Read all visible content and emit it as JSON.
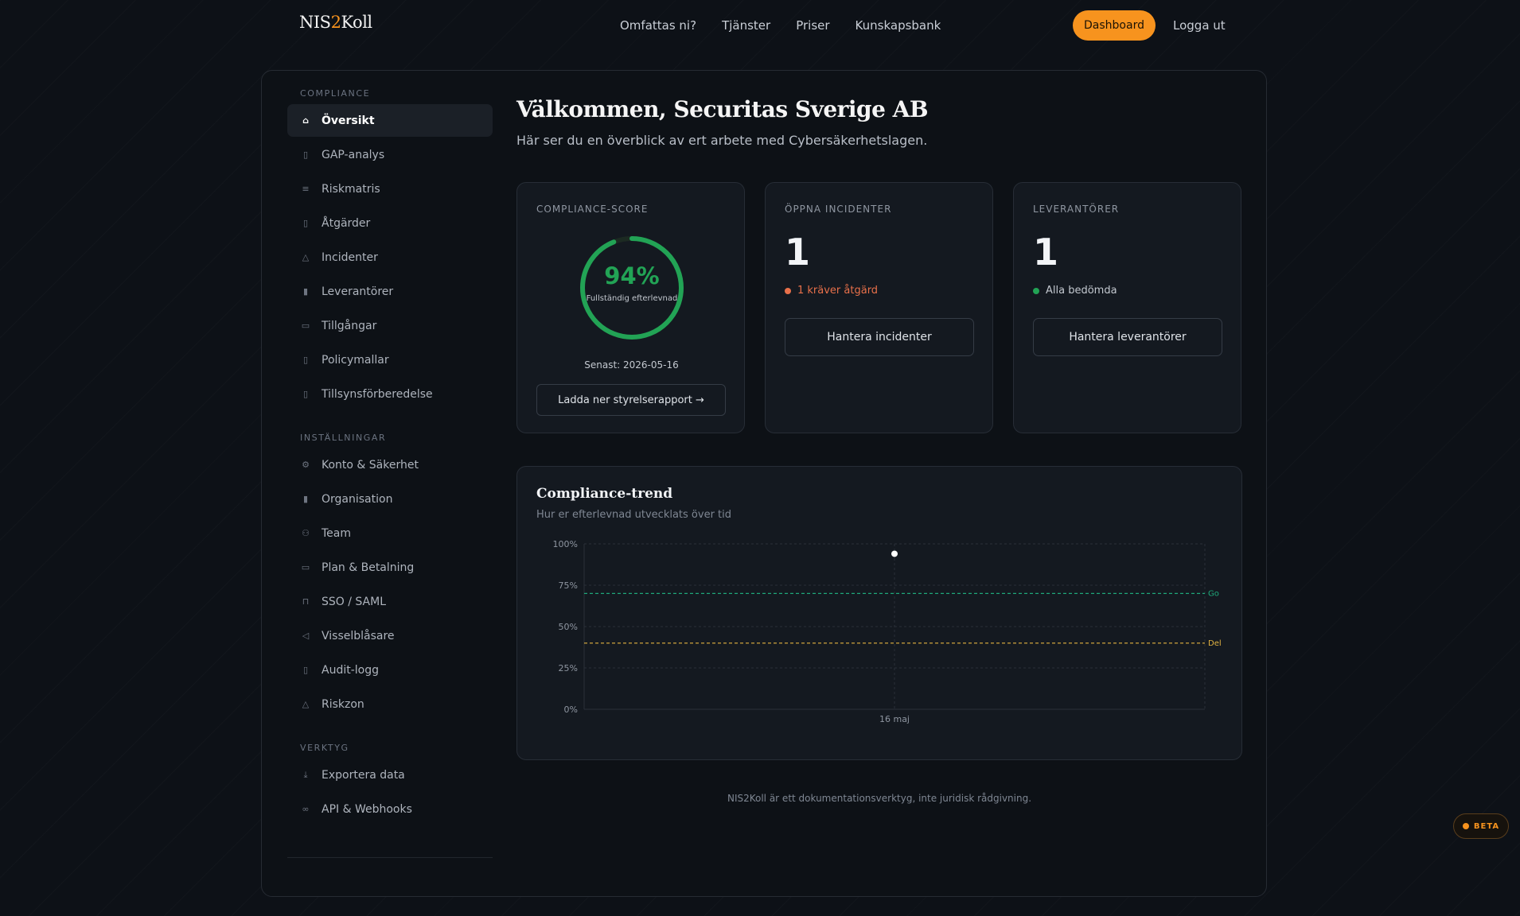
{
  "header": {
    "logo_prefix": "NIS",
    "logo_accent": "2",
    "logo_suffix": "Koll",
    "nav": [
      "Omfattas ni?",
      "Tjänster",
      "Priser",
      "Kunskapsbank"
    ],
    "dashboard_label": "Dashboard",
    "logout_label": "Logga ut"
  },
  "sidebar": {
    "compliance_title": "COMPLIANCE",
    "compliance_items": [
      {
        "label": "Översikt",
        "icon": "home-icon"
      },
      {
        "label": "GAP-analys",
        "icon": "clipboard-icon"
      },
      {
        "label": "Riskmatris",
        "icon": "list-icon"
      },
      {
        "label": "Åtgärder",
        "icon": "clipboard-check-icon"
      },
      {
        "label": "Incidenter",
        "icon": "warning-icon"
      },
      {
        "label": "Leverantörer",
        "icon": "building-icon"
      },
      {
        "label": "Tillgångar",
        "icon": "server-icon"
      },
      {
        "label": "Policymallar",
        "icon": "document-icon"
      },
      {
        "label": "Tillsynsförberedelse",
        "icon": "clipboard-icon"
      }
    ],
    "settings_title": "INSTÄLLNINGAR",
    "settings_items": [
      {
        "label": "Konto & Säkerhet",
        "icon": "gear-icon"
      },
      {
        "label": "Organisation",
        "icon": "building-icon"
      },
      {
        "label": "Team",
        "icon": "users-icon"
      },
      {
        "label": "Plan & Betalning",
        "icon": "credit-card-icon"
      },
      {
        "label": "SSO / SAML",
        "icon": "lock-icon"
      },
      {
        "label": "Visselblåsare",
        "icon": "megaphone-icon"
      },
      {
        "label": "Audit-logg",
        "icon": "document-icon"
      },
      {
        "label": "Riskzon",
        "icon": "warning-icon"
      }
    ],
    "tools_title": "VERKTYG",
    "tools_items": [
      {
        "label": "Exportera data",
        "icon": "download-icon"
      },
      {
        "label": "API & Webhooks",
        "icon": "link-icon"
      }
    ]
  },
  "main": {
    "welcome": "Välkommen, Securitas Sverige AB",
    "subtitle": "Här ser du en överblick av ert arbete med Cybersäkerhetslagen."
  },
  "cards": {
    "score": {
      "label": "COMPLIANCE-SCORE",
      "value": "94%",
      "value_fraction": 0.94,
      "sub": "Fullständig efterlevnad",
      "date": "Senast: 2026-05-16",
      "button": "Ladda ner styrelserapport →"
    },
    "incidents": {
      "label": "ÖPPNA INCIDENTER",
      "count": "1",
      "status": "1 kräver åtgärd",
      "button": "Hantera incidenter"
    },
    "suppliers": {
      "label": "LEVERANTÖRER",
      "count": "1",
      "status": "Alla bedömda",
      "button": "Hantera leverantörer"
    }
  },
  "colors": {
    "accent": "#f7931e",
    "success": "#22a355",
    "danger": "#e8704a",
    "goal_line": "#1fa87a",
    "partial_line": "#e3b341"
  },
  "chart_data": {
    "type": "line",
    "title": "Compliance-trend",
    "subtitle": "Hur er efterlevnad utvecklats över tid",
    "x": [
      "16 maj"
    ],
    "series": [
      {
        "values": [
          94
        ]
      }
    ],
    "y_ticks": [
      "0%",
      "25%",
      "50%",
      "75%",
      "100%"
    ],
    "ylim": [
      0,
      100
    ],
    "reference_lines": [
      {
        "label": "Go",
        "value": 70
      },
      {
        "label": "Del",
        "value": 40
      }
    ],
    "grid": true
  },
  "footer": {
    "note": "NIS2Koll är ett dokumentationsverktyg, inte juridisk rådgivning."
  },
  "beta_label": "BETA"
}
